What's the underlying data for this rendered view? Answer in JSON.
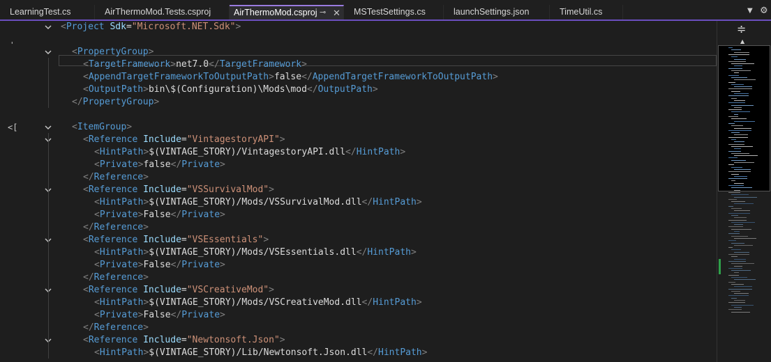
{
  "tabs": [
    {
      "label": "LearningTest.cs",
      "active": false
    },
    {
      "label": "AirThermoMod.Tests.csproj",
      "active": false
    },
    {
      "label": "AirThermoMod.csproj",
      "active": true
    },
    {
      "label": "MSTestSettings.cs",
      "active": false
    },
    {
      "label": "launchSettings.json",
      "active": false
    },
    {
      "label": "TimeUtil.cs",
      "active": false
    }
  ],
  "tab_icons": {
    "pin": "pin-icon",
    "close": "close-icon",
    "menu": "chevron-down-icon",
    "settings": "gear-icon",
    "pin_glyph": "⊸",
    "close_glyph": "✕",
    "menu_glyph": "▼",
    "settings_glyph": "⚙"
  },
  "colors": {
    "tag": "#569cd6",
    "attribute": "#9cdcfe",
    "string": "#ce9178",
    "text": "#d4d4d4",
    "bracket": "#808080",
    "active_tab_accent": "#9a7be0",
    "change_marker": "#2fa04a"
  },
  "margin_marks": [
    "'",
    "<["
  ],
  "minimap": {
    "split_icon": "split-editor-icon",
    "split_glyph": "≑",
    "up_glyph": "▲"
  },
  "lines": [
    {
      "indent": 0,
      "fold": true,
      "tokens": [
        [
          "b",
          "<"
        ],
        [
          "t",
          "Project"
        ],
        [
          "x",
          " "
        ],
        [
          "a",
          "Sdk"
        ],
        [
          "x",
          "="
        ],
        [
          "v",
          "\"Microsoft.NET.Sdk\""
        ],
        [
          "b",
          ">"
        ]
      ]
    },
    {
      "indent": 0,
      "fold": false,
      "tokens": []
    },
    {
      "indent": 1,
      "fold": true,
      "tokens": [
        [
          "b",
          "<"
        ],
        [
          "t",
          "PropertyGroup"
        ],
        [
          "b",
          ">"
        ]
      ]
    },
    {
      "indent": 2,
      "fold": false,
      "tokens": [
        [
          "b",
          "<"
        ],
        [
          "t",
          "TargetFramework"
        ],
        [
          "b",
          ">"
        ],
        [
          "x",
          "net7.0"
        ],
        [
          "b",
          "</"
        ],
        [
          "t",
          "TargetFramework"
        ],
        [
          "b",
          ">"
        ]
      ]
    },
    {
      "indent": 2,
      "fold": false,
      "tokens": [
        [
          "b",
          "<"
        ],
        [
          "t",
          "AppendTargetFrameworkToOutputPath"
        ],
        [
          "b",
          ">"
        ],
        [
          "x",
          "false"
        ],
        [
          "b",
          "</"
        ],
        [
          "t",
          "AppendTargetFrameworkToOutputPath"
        ],
        [
          "b",
          ">"
        ]
      ]
    },
    {
      "indent": 2,
      "fold": false,
      "tokens": [
        [
          "b",
          "<"
        ],
        [
          "t",
          "OutputPath"
        ],
        [
          "b",
          ">"
        ],
        [
          "x",
          "bin\\$(Configuration)\\Mods\\mod"
        ],
        [
          "b",
          "</"
        ],
        [
          "t",
          "OutputPath"
        ],
        [
          "b",
          ">"
        ]
      ]
    },
    {
      "indent": 1,
      "fold": false,
      "tokens": [
        [
          "b",
          "</"
        ],
        [
          "t",
          "PropertyGroup"
        ],
        [
          "b",
          ">"
        ]
      ]
    },
    {
      "indent": 0,
      "fold": false,
      "tokens": []
    },
    {
      "indent": 1,
      "fold": true,
      "tokens": [
        [
          "b",
          "<"
        ],
        [
          "t",
          "ItemGroup"
        ],
        [
          "b",
          ">"
        ]
      ]
    },
    {
      "indent": 2,
      "fold": true,
      "tokens": [
        [
          "b",
          "<"
        ],
        [
          "t",
          "Reference"
        ],
        [
          "x",
          " "
        ],
        [
          "a",
          "Include"
        ],
        [
          "x",
          "="
        ],
        [
          "v",
          "\"VintagestoryAPI\""
        ],
        [
          "b",
          ">"
        ]
      ]
    },
    {
      "indent": 3,
      "fold": false,
      "tokens": [
        [
          "b",
          "<"
        ],
        [
          "t",
          "HintPath"
        ],
        [
          "b",
          ">"
        ],
        [
          "x",
          "$(VINTAGE_STORY)/VintagestoryAPI.dll"
        ],
        [
          "b",
          "</"
        ],
        [
          "t",
          "HintPath"
        ],
        [
          "b",
          ">"
        ]
      ]
    },
    {
      "indent": 3,
      "fold": false,
      "tokens": [
        [
          "b",
          "<"
        ],
        [
          "t",
          "Private"
        ],
        [
          "b",
          ">"
        ],
        [
          "x",
          "false"
        ],
        [
          "b",
          "</"
        ],
        [
          "t",
          "Private"
        ],
        [
          "b",
          ">"
        ]
      ]
    },
    {
      "indent": 2,
      "fold": false,
      "tokens": [
        [
          "b",
          "</"
        ],
        [
          "t",
          "Reference"
        ],
        [
          "b",
          ">"
        ]
      ]
    },
    {
      "indent": 2,
      "fold": true,
      "tokens": [
        [
          "b",
          "<"
        ],
        [
          "t",
          "Reference"
        ],
        [
          "x",
          " "
        ],
        [
          "a",
          "Include"
        ],
        [
          "x",
          "="
        ],
        [
          "v",
          "\"VSSurvivalMod\""
        ],
        [
          "b",
          ">"
        ]
      ]
    },
    {
      "indent": 3,
      "fold": false,
      "tokens": [
        [
          "b",
          "<"
        ],
        [
          "t",
          "HintPath"
        ],
        [
          "b",
          ">"
        ],
        [
          "x",
          "$(VINTAGE_STORY)/Mods/VSSurvivalMod.dll"
        ],
        [
          "b",
          "</"
        ],
        [
          "t",
          "HintPath"
        ],
        [
          "b",
          ">"
        ]
      ]
    },
    {
      "indent": 3,
      "fold": false,
      "tokens": [
        [
          "b",
          "<"
        ],
        [
          "t",
          "Private"
        ],
        [
          "b",
          ">"
        ],
        [
          "x",
          "False"
        ],
        [
          "b",
          "</"
        ],
        [
          "t",
          "Private"
        ],
        [
          "b",
          ">"
        ]
      ]
    },
    {
      "indent": 2,
      "fold": false,
      "tokens": [
        [
          "b",
          "</"
        ],
        [
          "t",
          "Reference"
        ],
        [
          "b",
          ">"
        ]
      ]
    },
    {
      "indent": 2,
      "fold": true,
      "tokens": [
        [
          "b",
          "<"
        ],
        [
          "t",
          "Reference"
        ],
        [
          "x",
          " "
        ],
        [
          "a",
          "Include"
        ],
        [
          "x",
          "="
        ],
        [
          "v",
          "\"VSEssentials\""
        ],
        [
          "b",
          ">"
        ]
      ]
    },
    {
      "indent": 3,
      "fold": false,
      "tokens": [
        [
          "b",
          "<"
        ],
        [
          "t",
          "HintPath"
        ],
        [
          "b",
          ">"
        ],
        [
          "x",
          "$(VINTAGE_STORY)/Mods/VSEssentials.dll"
        ],
        [
          "b",
          "</"
        ],
        [
          "t",
          "HintPath"
        ],
        [
          "b",
          ">"
        ]
      ]
    },
    {
      "indent": 3,
      "fold": false,
      "tokens": [
        [
          "b",
          "<"
        ],
        [
          "t",
          "Private"
        ],
        [
          "b",
          ">"
        ],
        [
          "x",
          "False"
        ],
        [
          "b",
          "</"
        ],
        [
          "t",
          "Private"
        ],
        [
          "b",
          ">"
        ]
      ]
    },
    {
      "indent": 2,
      "fold": false,
      "tokens": [
        [
          "b",
          "</"
        ],
        [
          "t",
          "Reference"
        ],
        [
          "b",
          ">"
        ]
      ]
    },
    {
      "indent": 2,
      "fold": true,
      "tokens": [
        [
          "b",
          "<"
        ],
        [
          "t",
          "Reference"
        ],
        [
          "x",
          " "
        ],
        [
          "a",
          "Include"
        ],
        [
          "x",
          "="
        ],
        [
          "v",
          "\"VSCreativeMod\""
        ],
        [
          "b",
          ">"
        ]
      ]
    },
    {
      "indent": 3,
      "fold": false,
      "tokens": [
        [
          "b",
          "<"
        ],
        [
          "t",
          "HintPath"
        ],
        [
          "b",
          ">"
        ],
        [
          "x",
          "$(VINTAGE_STORY)/Mods/VSCreativeMod.dll"
        ],
        [
          "b",
          "</"
        ],
        [
          "t",
          "HintPath"
        ],
        [
          "b",
          ">"
        ]
      ]
    },
    {
      "indent": 3,
      "fold": false,
      "tokens": [
        [
          "b",
          "<"
        ],
        [
          "t",
          "Private"
        ],
        [
          "b",
          ">"
        ],
        [
          "x",
          "False"
        ],
        [
          "b",
          "</"
        ],
        [
          "t",
          "Private"
        ],
        [
          "b",
          ">"
        ]
      ]
    },
    {
      "indent": 2,
      "fold": false,
      "tokens": [
        [
          "b",
          "</"
        ],
        [
          "t",
          "Reference"
        ],
        [
          "b",
          ">"
        ]
      ]
    },
    {
      "indent": 2,
      "fold": true,
      "tokens": [
        [
          "b",
          "<"
        ],
        [
          "t",
          "Reference"
        ],
        [
          "x",
          " "
        ],
        [
          "a",
          "Include"
        ],
        [
          "x",
          "="
        ],
        [
          "v",
          "\"Newtonsoft.Json\""
        ],
        [
          "b",
          ">"
        ]
      ]
    },
    {
      "indent": 3,
      "fold": false,
      "tokens": [
        [
          "b",
          "<"
        ],
        [
          "t",
          "HintPath"
        ],
        [
          "b",
          ">"
        ],
        [
          "x",
          "$(VINTAGE_STORY)/Lib/Newtonsoft.Json.dll"
        ],
        [
          "b",
          "</"
        ],
        [
          "t",
          "HintPath"
        ],
        [
          "b",
          ">"
        ]
      ]
    }
  ]
}
